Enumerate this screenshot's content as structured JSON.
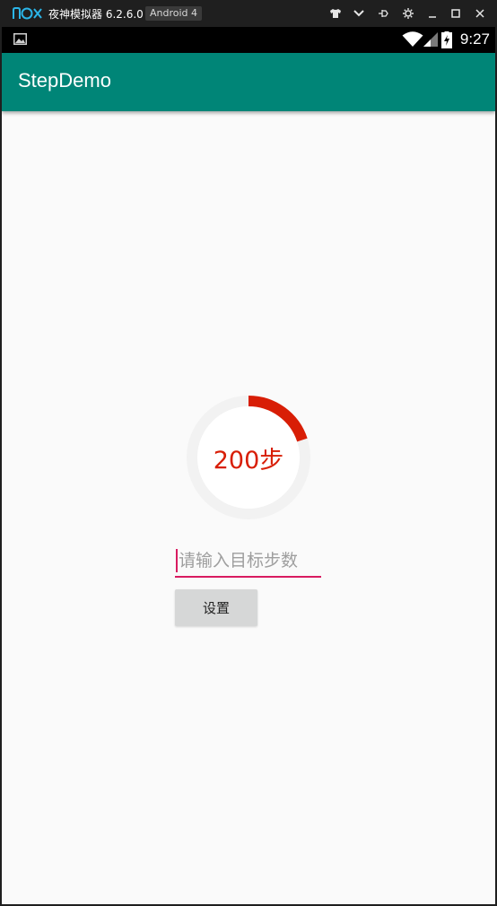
{
  "emulator": {
    "title": "夜神模拟器 6.2.6.0",
    "badge": "Android 4",
    "controls": [
      "shirt-icon",
      "chevron-down-icon",
      "pin-icon",
      "gear-icon",
      "minimize-icon",
      "maximize-icon",
      "close-icon"
    ]
  },
  "status_bar": {
    "time": "9:27",
    "icons": [
      "image-notification-icon",
      "wifi-icon",
      "signal-icon",
      "battery-icon"
    ]
  },
  "app_bar": {
    "title": "StepDemo",
    "color": "#008577"
  },
  "progress": {
    "label": "200步",
    "fraction": 0.2,
    "color": "#d81e06",
    "track_color": "#f2f2f2"
  },
  "target_input": {
    "value": "",
    "placeholder": "请输入目标步数"
  },
  "set_button": {
    "label": "设置"
  }
}
